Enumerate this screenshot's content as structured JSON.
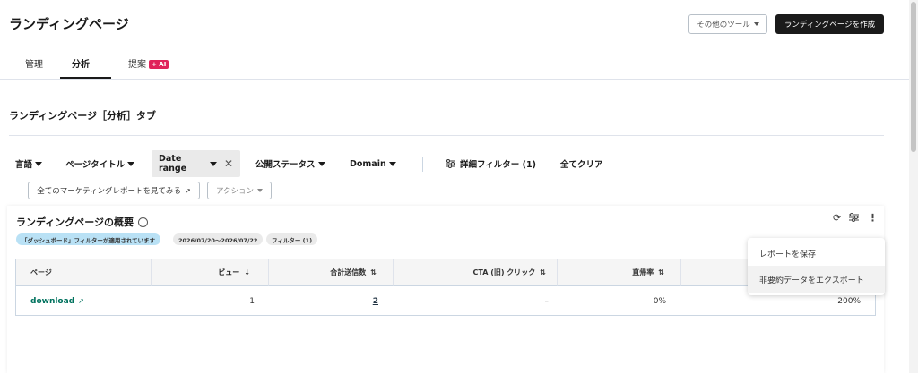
{
  "header": {
    "title": "ランディングページ",
    "other_tools": "その他のツール",
    "create_button": "ランディングページを作成"
  },
  "tabs": [
    {
      "label": "管理"
    },
    {
      "label": "分析"
    },
    {
      "label": "提案",
      "badge": "+ AI"
    }
  ],
  "section": {
    "title": "ランディングページ［分析］タブ"
  },
  "filters": {
    "language": "言語",
    "page_title": "ページタイトル",
    "date_range": "Date range",
    "status": "公開ステータス",
    "domain": "Domain",
    "advanced": "詳細フィルター (1)",
    "clear_all": "全てクリア"
  },
  "actions": {
    "marketing_reports": "全てのマーケティングレポートを見てみる",
    "action_dropdown": "アクション"
  },
  "panel": {
    "title": "ランディングページの概要",
    "pill_dashboard": "「ダッシュボード」フィルターが適用されています",
    "pill_dates": "2026/07/20〜2026/07/22",
    "pill_filter": "フィルター (1)"
  },
  "table": {
    "columns": [
      "ページ",
      "ビュー",
      "合計送信数",
      "CTA (旧) クリック",
      "直帰率"
    ],
    "rows": [
      {
        "page": "download",
        "views": "1",
        "submissions": "2",
        "cta": "–",
        "bounce": "0%",
        "last": "200%"
      }
    ]
  },
  "menu": {
    "save_report": "レポートを保存",
    "export": "非要約データをエクスポート"
  },
  "colors": {
    "primary_dark": "#1a1a1a",
    "ai_badge": "#e0235a",
    "link_green": "#00725e",
    "pill_blue": "#b9e1f5"
  }
}
